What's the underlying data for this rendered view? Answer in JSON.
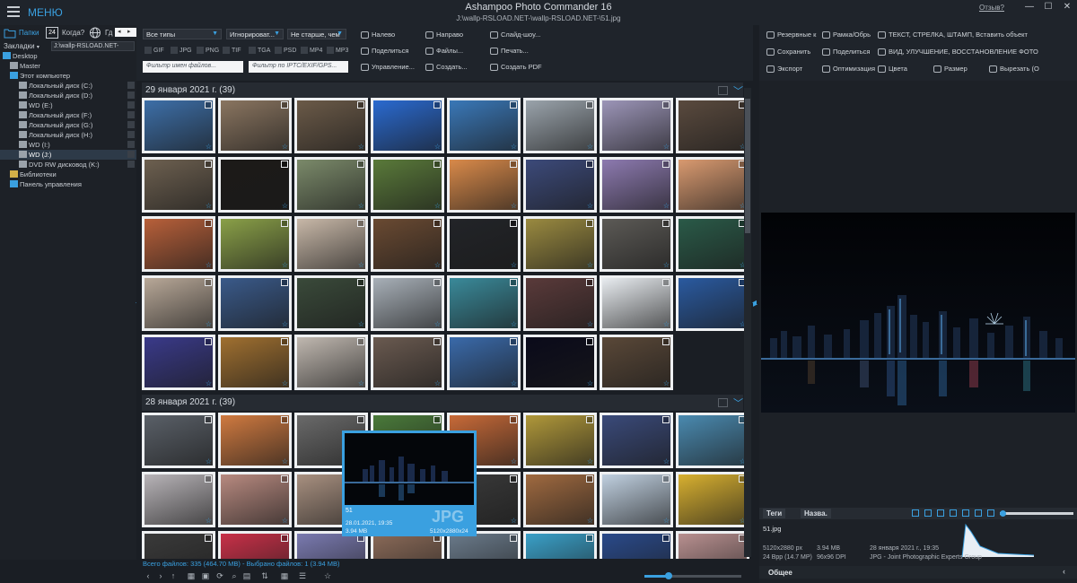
{
  "titlebar": {
    "menu_label": "МЕНЮ",
    "app_title": "Ashampoo Photo Commander 16",
    "path": "J:\\wallp-RSLOAD.NET-\\wallp-RSLOAD.NET-\\51.jpg",
    "help": "Отзыв?",
    "minimize": "—",
    "restore": "☐",
    "close": "✕"
  },
  "left": {
    "tabs": {
      "folders": "Папки",
      "when": "Когда?",
      "cal_num": "24",
      "more": "Гд"
    },
    "bookmarks": "Закладки",
    "path_box": "J:\\wallp-RSLOAD.NET-",
    "tree": [
      {
        "label": "Desktop",
        "icon": "desktop-icon",
        "color": "#3aa0e0"
      },
      {
        "label": "Master",
        "icon": "user-icon",
        "color": "#9aa2aa"
      },
      {
        "label": "Этот компьютер",
        "icon": "computer-icon",
        "color": "#3aa0e0"
      },
      {
        "label": "Локальный диск (C:)",
        "icon": "drive-icon",
        "color": "#9aa2aa"
      },
      {
        "label": "Локальный диск (D:)",
        "icon": "drive-icon",
        "color": "#9aa2aa"
      },
      {
        "label": "WD (E:)",
        "icon": "drive-icon",
        "color": "#9aa2aa"
      },
      {
        "label": "Локальный диск (F:)",
        "icon": "drive-icon",
        "color": "#9aa2aa"
      },
      {
        "label": "Локальный диск (G:)",
        "icon": "drive-icon",
        "color": "#9aa2aa"
      },
      {
        "label": "Локальный диск (H:)",
        "icon": "drive-icon",
        "color": "#9aa2aa"
      },
      {
        "label": "WD (I:)",
        "icon": "drive-icon",
        "color": "#9aa2aa"
      },
      {
        "label": "WD (J:)",
        "icon": "drive-icon",
        "color": "#9aa2aa",
        "selected": true
      },
      {
        "label": "DVD RW дисковод (K:)",
        "icon": "dvd-icon",
        "color": "#9aa2aa"
      },
      {
        "label": "Библиотеки",
        "icon": "library-icon",
        "color": "#d4b048"
      },
      {
        "label": "Панель управления",
        "icon": "control-panel-icon",
        "color": "#3aa0e0"
      }
    ]
  },
  "center_toolbar": {
    "type_filter": "Все типы",
    "ignore_filter": "Игнорироват...",
    "age_filter": "Не старше, чем",
    "file_types": [
      "GIF",
      "JPG",
      "PNG",
      "TIF",
      "TGA",
      "PSD",
      "MP4",
      "MP3"
    ],
    "filename_filter_placeholder": "Фильтр имен файлов...",
    "iptc_filter_placeholder": "Фильтр по IPTC/EXIF/GPS...",
    "actions": [
      {
        "label": "Налево",
        "icon": "rotate-left-icon"
      },
      {
        "label": "Направо",
        "icon": "rotate-right-icon"
      },
      {
        "label": "Слайд-шоу...",
        "icon": "slideshow-icon"
      },
      {
        "label": "Поделиться",
        "icon": "share-icon"
      },
      {
        "label": "Файлы...",
        "icon": "files-icon"
      },
      {
        "label": "Печать...",
        "icon": "print-icon"
      },
      {
        "label": "Управление...",
        "icon": "manage-icon"
      },
      {
        "label": "Создать...",
        "icon": "create-icon"
      },
      {
        "label": "Создать PDF",
        "icon": "pdf-icon"
      }
    ]
  },
  "groups": [
    {
      "label": "29 января 2021 г. (39)"
    },
    {
      "label": "28 января 2021 г. (39)"
    }
  ],
  "thumb_colors_g1": [
    [
      "#3d6fa8",
      "#8a7560",
      "#6b5a48",
      "#2a6ad0",
      "#3a78b8",
      "#9aa3ab",
      "#9c95b8",
      "#5a4a3e"
    ],
    [
      "#6d6050",
      "#1c1a18",
      "#7b8a6a",
      "#5a7a3a",
      "#d98a4a",
      "#3c4a7a",
      "#8d7ab0",
      "#d99a70"
    ],
    [
      "#b8603a",
      "#8aa048",
      "#c8b8a8",
      "#6a4a32",
      "#222428",
      "#9a8a40",
      "#5c5a56",
      "#2a5a48"
    ],
    [
      "#b8a898",
      "#3a5a8a",
      "#3a4a3a",
      "#a8b0b8",
      "#3a8a9a",
      "#5a3a3a",
      "#e8ecf0",
      "#2a5aa0"
    ],
    [
      "#3a3a8a",
      "#a07030",
      "#c0b8b0",
      "#6a5a50",
      "#3a6aaa",
      "#0a0a1a",
      "#5a4838",
      null
    ]
  ],
  "thumb_colors_g2": [
    [
      "#5a6068",
      "#d07a40",
      "#6a6a6a",
      "#4a7a3a",
      "#c86a38",
      "#b0983a",
      "#3a4a7a",
      "#4a8ab0"
    ],
    [
      "#b8b4b8",
      "#b88a80",
      "#a89080",
      null,
      "#3a3a3a",
      "#a06a40",
      "#c0d0e0",
      "#d8b030"
    ],
    [
      "#3a3a3a",
      "#c83048",
      "#7a7ab0",
      "#8a6a58",
      "#6a7a8a",
      "#3aa0c8",
      "#2a4a8a",
      "#b89090"
    ]
  ],
  "hover": {
    "name": "51",
    "date": "28.01.2021, 19:35",
    "size": "3.94 MB",
    "dims": "5120x2880x24",
    "format": "JPG"
  },
  "status": {
    "text": "Всего файлов: 335 (464.70 MB) - Выбрано файлов: 1 (3.94 MB)",
    "zoom_fraction": 0.25
  },
  "right_toolbar": {
    "actions": [
      {
        "label": "Резервные к",
        "icon": "backup-icon"
      },
      {
        "label": "Рамка/Обрь",
        "icon": "crop-icon"
      },
      {
        "label": "ТЕКСТ, СТРЕЛКА, ШТАМП, Вставить объект",
        "icon": "text-icon"
      },
      {
        "label": "Сохранить",
        "icon": "save-icon"
      },
      {
        "label": "Поделиться",
        "icon": "share-icon"
      },
      {
        "label": "ВИД, УЛУЧШЕНИЕ, ВОССТАНОВЛЕНИЕ ФОТО",
        "icon": "enhance-icon"
      },
      {
        "label": "Экспорт",
        "icon": "export-icon"
      },
      {
        "label": "Оптимизация",
        "icon": "optimize-icon"
      },
      {
        "label": "Цвета",
        "icon": "colors-icon"
      },
      {
        "label": "Размер",
        "icon": "resize-icon"
      },
      {
        "label": "Вырезать (О",
        "icon": "cut-icon"
      }
    ]
  },
  "right_tabs": {
    "tags": "Теги",
    "names": "Назва."
  },
  "info": {
    "filename": "51.jpg",
    "dims": "5120x2880 px",
    "filesize": "3.94 MB",
    "date": "28 января 2021 г., 19:35",
    "bpp": "24 Bpp (14.7 MP)",
    "dpi": "96x96 DPI",
    "format": "JPG - Joint Photographic Experts Group"
  },
  "general_label": "Общее",
  "colors": {
    "accent": "#3aa0e0",
    "background": "#1a1e24",
    "panel": "#1f242b"
  }
}
